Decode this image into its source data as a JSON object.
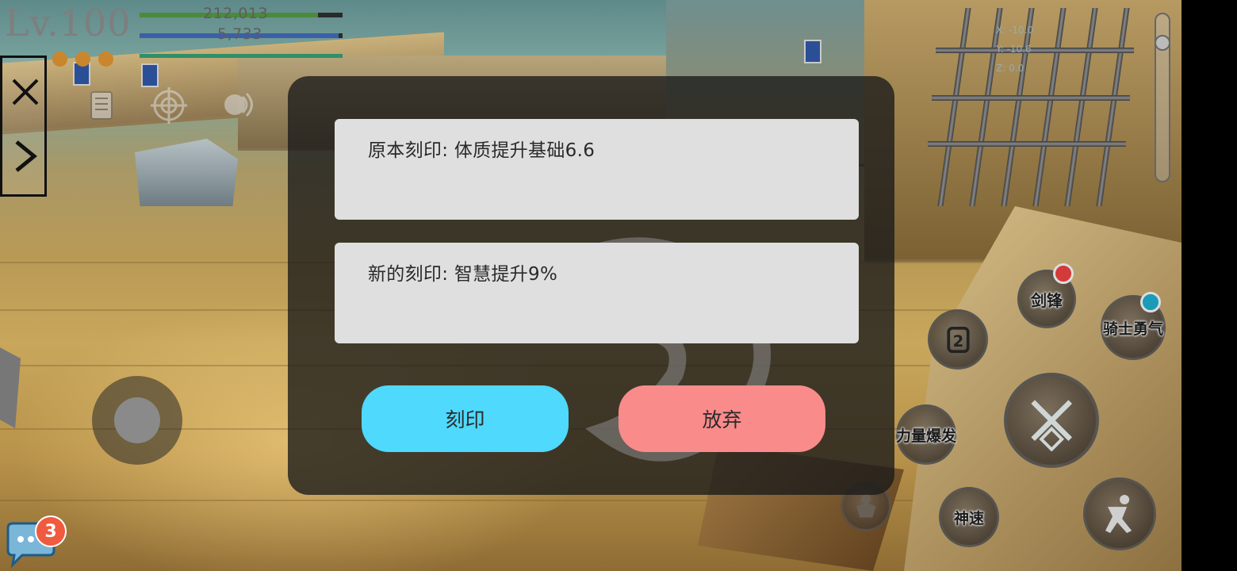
{
  "hud": {
    "level": "Lv.100",
    "hp_value": "212,013",
    "mp_value": "5,733",
    "hp_fraction": 0.88,
    "mp_fraction": 0.98,
    "xp_fraction": 1.0,
    "coords": {
      "x": "X: -10.0",
      "y": "Y: -10.6",
      "z": "Z: 0.0"
    },
    "orbs": [
      "#c9862c",
      "#c9862c",
      "#c9862c",
      "#222222"
    ]
  },
  "dialog": {
    "original_rune": "原本刻印: 体质提升基础6.6",
    "new_rune": "新的刻印: 智慧提升9%",
    "engrave_label": "刻印",
    "discard_label": "放弃",
    "engrave_color": "#4fd9fc",
    "discard_color": "#f98b8b"
  },
  "skills": {
    "sword_edge": "剑锋",
    "knight_courage": "骑士勇气",
    "power_burst": "力量爆发",
    "god_speed": "神速",
    "slot_number": "2"
  },
  "chat": {
    "unread": "3"
  }
}
